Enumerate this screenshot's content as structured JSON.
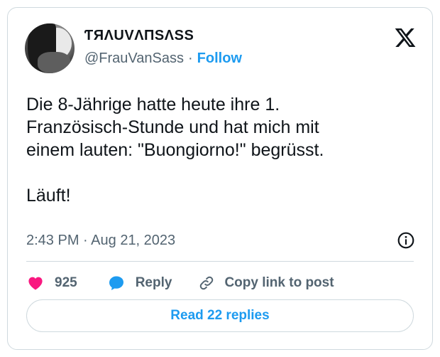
{
  "author": {
    "display_name": "ƬЯΛUVΛПSΛSS",
    "handle": "@FrauVanSass",
    "separator": "·",
    "follow_label": "Follow"
  },
  "tweet": {
    "lines": [
      "Die 8-Jährige hatte heute ihre 1.",
      "Französisch-Stunde und hat mich mit",
      "einem lauten: \"Buongiorno!\" begrüsst."
    ],
    "closing": "Läuft!",
    "time": "2:43 PM",
    "time_separator": "·",
    "date": "Aug 21, 2023"
  },
  "actions": {
    "likes_count": "925",
    "reply_label": "Reply",
    "copy_link_label": "Copy link to post"
  },
  "read_replies_label": "Read 22 replies",
  "colors": {
    "accent": "#1d9bf0",
    "like": "#f91880",
    "text": "#0f1419",
    "muted": "#536471",
    "border": "#cfd9de"
  },
  "icons": [
    "x-logo-icon",
    "info-icon",
    "heart-icon",
    "reply-bubble-icon",
    "link-icon"
  ]
}
